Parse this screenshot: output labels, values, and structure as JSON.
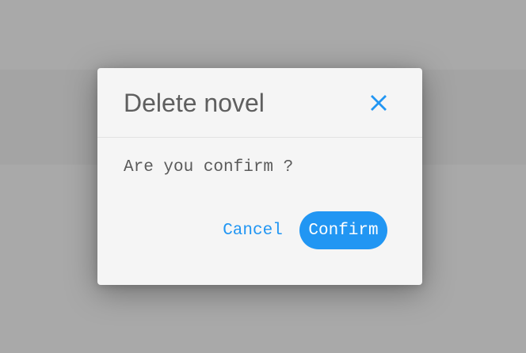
{
  "dialog": {
    "title": "Delete novel",
    "message": "Are you confirm ?",
    "close_icon": "close-icon",
    "cancel_label": "Cancel",
    "confirm_label": "Confirm"
  },
  "colors": {
    "accent": "#2196f3",
    "overlay": "#a9a9a9",
    "dialog_background": "#f5f5f5",
    "title_text": "#5f5f5f"
  }
}
